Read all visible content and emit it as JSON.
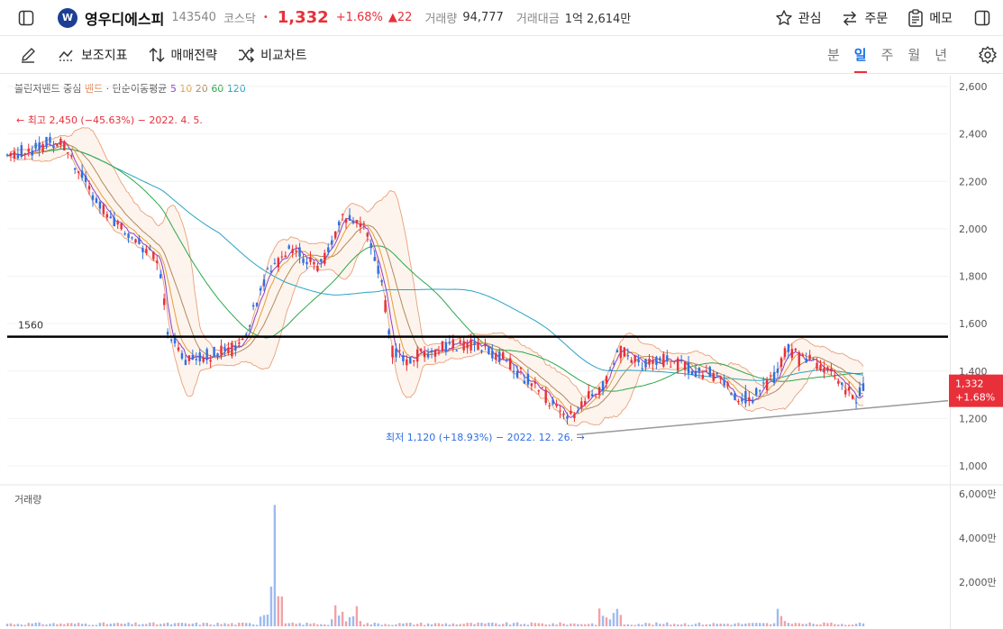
{
  "header": {
    "logo_text": "W",
    "stock_name": "영우디에스피",
    "code": "143540",
    "market": "코스닥",
    "price": "1,332",
    "change_pct": "+1.68%",
    "change_abs": "▲22",
    "volume_label": "거래량",
    "volume_value": "94,777",
    "amount_label": "거래대금",
    "amount_value": "1억 2,614만",
    "watch_label": "관심",
    "order_label": "주문",
    "memo_label": "메모"
  },
  "toolbar": {
    "indicator_label": "보조지표",
    "strategy_label": "매매전략",
    "compare_label": "비교차트",
    "periods": [
      "분",
      "일",
      "주",
      "월",
      "년"
    ],
    "active_period": "일"
  },
  "legend": {
    "bb": "볼린저밴드 중심",
    "band": "밴드",
    "ma": "· 단순이동평균",
    "ma5": "5",
    "ma10": "10",
    "ma20": "20",
    "ma60": "60",
    "ma120": "120"
  },
  "colors": {
    "up": "#e8303a",
    "down": "#2f6fe0",
    "ma5": "#8b3fc9",
    "ma10": "#e5a03a",
    "ma20": "#b08a60",
    "ma60": "#2aa84a",
    "ma120": "#27a3c4",
    "band": "#f3a07a"
  },
  "chart_data": {
    "type": "line",
    "ylim": [
      1000,
      2600
    ],
    "y_ticks": [
      "2,600",
      "2,400",
      "2,200",
      "2,000",
      "1,800",
      "1,600",
      "1,400",
      "1,200",
      "1,000"
    ],
    "annotations": {
      "high": "← 최고 2,450 (−45.63%) − 2022. 4. 5.",
      "low": "최저 1,120 (+18.93%) − 2022. 12. 26. →",
      "hline_label": "1560",
      "hline_value": 1560,
      "current_price": "1,332",
      "current_change": "+1.68%"
    },
    "volume": {
      "label": "거래량",
      "y_ticks": [
        "6,000만",
        "4,000만",
        "2,000만"
      ]
    }
  }
}
